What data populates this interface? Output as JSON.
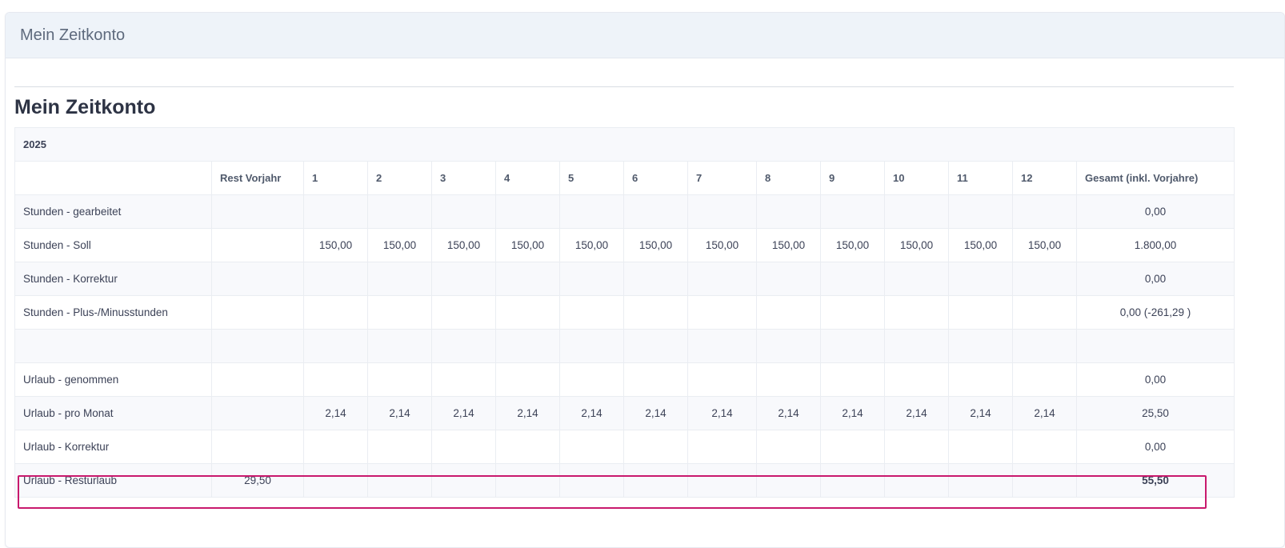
{
  "card": {
    "header_title": "Mein Zeitkonto"
  },
  "page_title": "Mein Zeitkonto",
  "table": {
    "year": "2025",
    "columns": [
      "",
      "Rest Vorjahr",
      "1",
      "2",
      "3",
      "4",
      "5",
      "6",
      "7",
      "8",
      "9",
      "10",
      "11",
      "12",
      "Gesamt (inkl. Vorjahre)"
    ],
    "rows": [
      {
        "label": "Stunden - gearbeitet",
        "rest": "",
        "months": [
          "",
          "",
          "",
          "",
          "",
          "",
          "",
          "",
          "",
          "",
          "",
          ""
        ],
        "total": "0,00"
      },
      {
        "label": "Stunden - Soll",
        "rest": "",
        "months": [
          "150,00",
          "150,00",
          "150,00",
          "150,00",
          "150,00",
          "150,00",
          "150,00",
          "150,00",
          "150,00",
          "150,00",
          "150,00",
          "150,00"
        ],
        "total": "1.800,00"
      },
      {
        "label": "Stunden - Korrektur",
        "rest": "",
        "months": [
          "",
          "",
          "",
          "",
          "",
          "",
          "",
          "",
          "",
          "",
          "",
          ""
        ],
        "total": "0,00"
      },
      {
        "label": "Stunden - Plus-/Minusstunden",
        "rest": "",
        "months": [
          "",
          "",
          "",
          "",
          "",
          "",
          "",
          "",
          "",
          "",
          "",
          ""
        ],
        "total": "0,00 (-261,29 )"
      },
      {
        "label": "",
        "rest": "",
        "months": [
          "",
          "",
          "",
          "",
          "",
          "",
          "",
          "",
          "",
          "",
          "",
          ""
        ],
        "total": ""
      },
      {
        "label": "Urlaub - genommen",
        "rest": "",
        "months": [
          "",
          "",
          "",
          "",
          "",
          "",
          "",
          "",
          "",
          "",
          "",
          ""
        ],
        "total": "0,00"
      },
      {
        "label": "Urlaub - pro Monat",
        "rest": "",
        "months": [
          "2,14",
          "2,14",
          "2,14",
          "2,14",
          "2,14",
          "2,14",
          "2,14",
          "2,14",
          "2,14",
          "2,14",
          "2,14",
          "2,14"
        ],
        "total": "25,50"
      },
      {
        "label": "Urlaub - Korrektur",
        "rest": "",
        "months": [
          "",
          "",
          "",
          "",
          "",
          "",
          "",
          "",
          "",
          "",
          "",
          ""
        ],
        "total": "0,00"
      },
      {
        "label": "Urlaub - Resturlaub",
        "rest": "29,50",
        "months": [
          "",
          "",
          "",
          "",
          "",
          "",
          "",
          "",
          "",
          "",
          "",
          ""
        ],
        "total": "55,50",
        "bold_total": true,
        "highlighted": true
      }
    ]
  },
  "colors": {
    "header_bg": "#eef3f9",
    "alt_row_bg": "#f8f9fc",
    "highlight_border": "#c8196d",
    "title_text": "#2d3344"
  }
}
